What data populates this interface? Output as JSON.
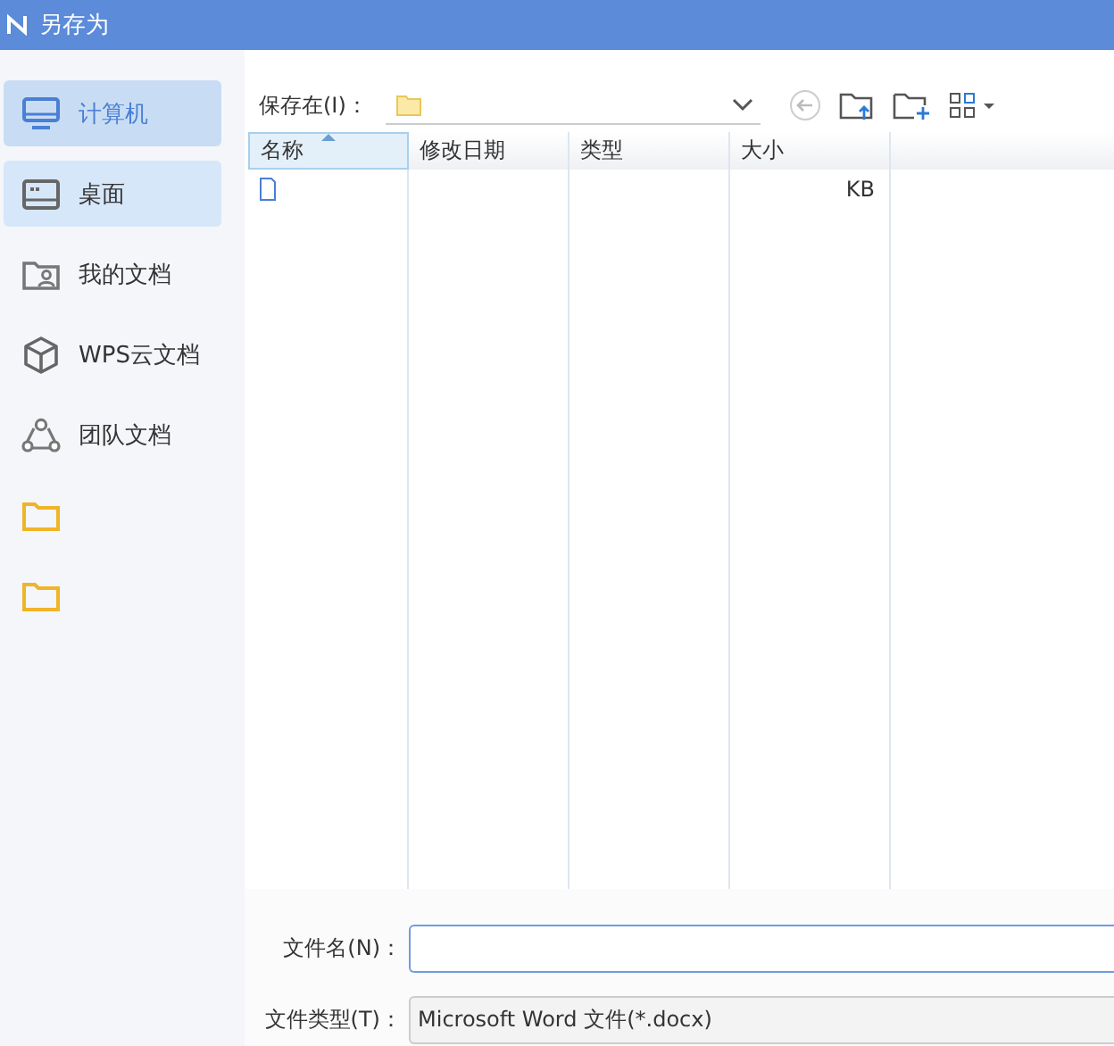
{
  "window": {
    "title": "另存为"
  },
  "sidebar": {
    "items": [
      {
        "kind": "computer",
        "label": "计算机",
        "selected": true,
        "hovered": false
      },
      {
        "kind": "desktop",
        "label": "桌面",
        "selected": false,
        "hovered": true
      },
      {
        "kind": "my-docs",
        "label": "我的文档",
        "selected": false,
        "hovered": false
      },
      {
        "kind": "cloud",
        "label": "WPS云文档",
        "selected": false,
        "hovered": false
      },
      {
        "kind": "team",
        "label": "团队文档",
        "selected": false,
        "hovered": false
      },
      {
        "kind": "folder",
        "selected": false,
        "hovered": false
      },
      {
        "kind": "folder",
        "selected": false,
        "hovered": false
      }
    ]
  },
  "location": {
    "label": "保存在(I)："
  },
  "table": {
    "columns": [
      {
        "label": "名称",
        "sorted": true
      },
      {
        "label": "修改日期",
        "sorted": false
      },
      {
        "label": "类型",
        "sorted": false
      },
      {
        "label": "大小",
        "sorted": false
      }
    ],
    "rows": [
      {
        "size": "KB"
      }
    ]
  },
  "file_name": {
    "label": "文件名(N)："
  },
  "file_type": {
    "label": "文件类型(T)：",
    "value": "Microsoft Word 文件(*.docx)"
  }
}
